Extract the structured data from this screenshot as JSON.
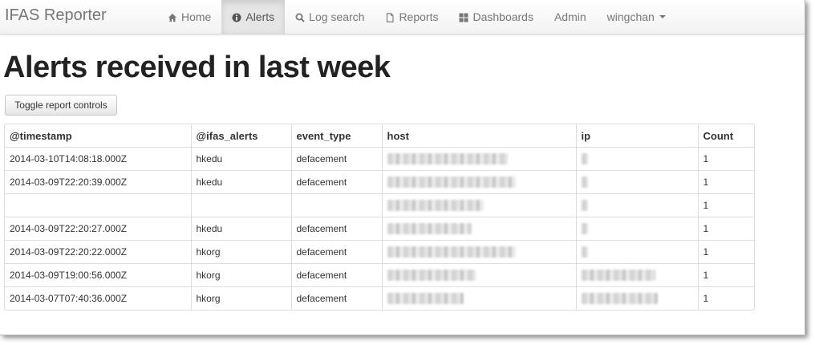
{
  "brand": "IFAS Reporter",
  "nav": [
    {
      "label": "Home",
      "icon": "home-icon",
      "active": false
    },
    {
      "label": "Alerts",
      "icon": "info-circle-icon",
      "active": true
    },
    {
      "label": "Log search",
      "icon": "search-icon",
      "active": false
    },
    {
      "label": "Reports",
      "icon": "document-icon",
      "active": false
    },
    {
      "label": "Dashboards",
      "icon": "grid-icon",
      "active": false
    },
    {
      "label": "Admin",
      "icon": "",
      "active": false
    },
    {
      "label": "wingchan",
      "icon": "",
      "active": false
    }
  ],
  "page_title": "Alerts received in last week",
  "toggle_button": "Toggle report controls",
  "table": {
    "headers": [
      "@timestamp",
      "@ifas_alerts",
      "event_type",
      "host",
      "ip",
      "Count"
    ],
    "rows": [
      {
        "timestamp": "2014-03-10T14:08:18.000Z",
        "alerts": "hkedu",
        "event_type": "defacement",
        "count": "1"
      },
      {
        "timestamp": "2014-03-09T22:20:39.000Z",
        "alerts": "hkedu",
        "event_type": "defacement",
        "count": "1"
      },
      {
        "timestamp": "",
        "alerts": "",
        "event_type": "",
        "count": "1"
      },
      {
        "timestamp": "2014-03-09T22:20:27.000Z",
        "alerts": "hkedu",
        "event_type": "defacement",
        "count": "1"
      },
      {
        "timestamp": "2014-03-09T22:20:22.000Z",
        "alerts": "hkorg",
        "event_type": "defacement",
        "count": "1"
      },
      {
        "timestamp": "2014-03-09T19:00:56.000Z",
        "alerts": "hkorg",
        "event_type": "defacement",
        "count": "1"
      },
      {
        "timestamp": "2014-03-07T07:40:36.000Z",
        "alerts": "hkorg",
        "event_type": "defacement",
        "count": "1"
      }
    ]
  }
}
